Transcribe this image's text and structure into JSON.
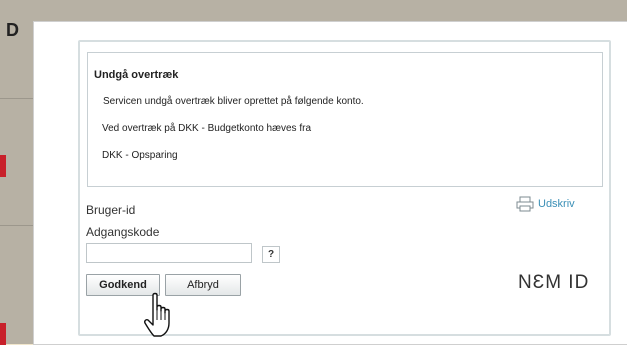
{
  "backdrop": {
    "letter": "D",
    "accent_color": "#c8202a"
  },
  "dialog": {
    "info": {
      "title": "Undgå overtræk",
      "lines": [
        "Servicen undgå overtræk bliver oprettet på følgende konto.",
        "Ved overtræk på  DKK - Budgetkonto hæves fra",
        "DKK - Opsparing"
      ]
    },
    "print_label": "Udskriv",
    "user_id_label": "Bruger-id",
    "password_label": "Adgangskode",
    "password_value": "",
    "help_label": "?",
    "approve_label": "Godkend",
    "cancel_label": "Afbryd",
    "logo_text": "NƐM ID",
    "link_color": "#3a8fb6"
  }
}
